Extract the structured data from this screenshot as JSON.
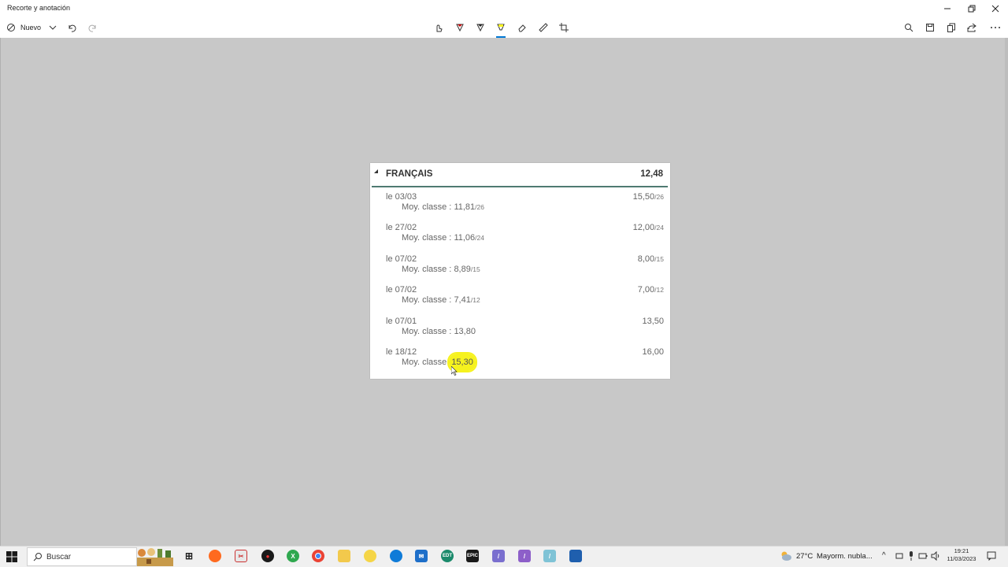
{
  "window": {
    "title": "Recorte y anotación",
    "controls": [
      "minimize-icon",
      "restore-icon",
      "close-icon"
    ]
  },
  "toolbar": {
    "new_label": "Nuevo",
    "left_tools": [
      "new-snip-icon",
      "chevron-down-icon",
      "undo-icon",
      "redo-icon"
    ],
    "center_tools": [
      "touch-writing-icon",
      "ballpoint-pen-icon",
      "pencil-icon",
      "highlighter-icon",
      "eraser-icon",
      "ruler-icon",
      "crop-icon"
    ],
    "active_tool": "highlighter",
    "right_tools": [
      "zoom-icon",
      "save-icon",
      "copy-icon",
      "share-icon",
      "more-icon"
    ]
  },
  "card": {
    "subject": "FRANÇAIS",
    "average": "12,48",
    "rows": [
      {
        "date": "le 03/03",
        "class_label": "Moy. classe : ",
        "class_avg": "11,81",
        "class_den": "/26",
        "grade": "15,50",
        "grade_den": "/26"
      },
      {
        "date": "le 27/02",
        "class_label": "Moy. classe : ",
        "class_avg": "11,06",
        "class_den": "/24",
        "grade": "12,00",
        "grade_den": "/24"
      },
      {
        "date": "le 07/02",
        "class_label": "Moy. classe : ",
        "class_avg": "8,89",
        "class_den": "/15",
        "grade": "8,00",
        "grade_den": "/15"
      },
      {
        "date": "le 07/02",
        "class_label": "Moy. classe : ",
        "class_avg": "7,41",
        "class_den": "/12",
        "grade": "7,00",
        "grade_den": "/12"
      },
      {
        "date": "le 07/01",
        "class_label": "Moy. classe : ",
        "class_avg": "13,80",
        "class_den": "",
        "grade": "13,50",
        "grade_den": ""
      },
      {
        "date": "le 18/12",
        "class_label": "Moy. classe ",
        "class_avg": "15,30",
        "class_den": "",
        "grade": "16,00",
        "grade_den": ""
      }
    ],
    "highlighted_value": "15,30",
    "highlight_color": "#f6f21e",
    "header_rule_color": "#4f7a72"
  },
  "taskbar": {
    "search_placeholder": "Buscar",
    "weather_temp": "27°C",
    "weather_text": "Mayorm. nubla...",
    "time": "19:21",
    "date": "11/03/2023"
  },
  "colors": {
    "accent": "#0078d4",
    "canvas": "#c8c8c8"
  }
}
